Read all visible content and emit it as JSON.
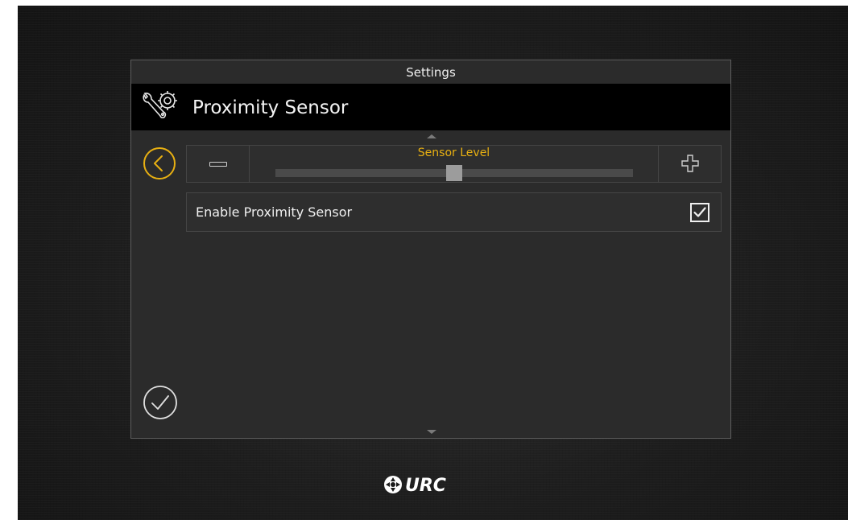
{
  "panel": {
    "title": "Settings",
    "header_title": "Proximity Sensor",
    "header_icon": "wrench-gear-icon"
  },
  "sensor_level": {
    "label": "Sensor Level",
    "value_fraction": 0.5,
    "minus_icon": "minus-icon",
    "plus_icon": "plus-icon"
  },
  "enable_option": {
    "label": "Enable Proximity Sensor",
    "checked": true
  },
  "nav": {
    "back_icon": "chevron-left-circle-icon",
    "confirm_icon": "checkmark-circle-icon"
  },
  "logo": {
    "text": "URC"
  },
  "colors": {
    "accent": "#e8b012",
    "panel_bg": "#2b2b2b",
    "header_bg": "#000000"
  }
}
